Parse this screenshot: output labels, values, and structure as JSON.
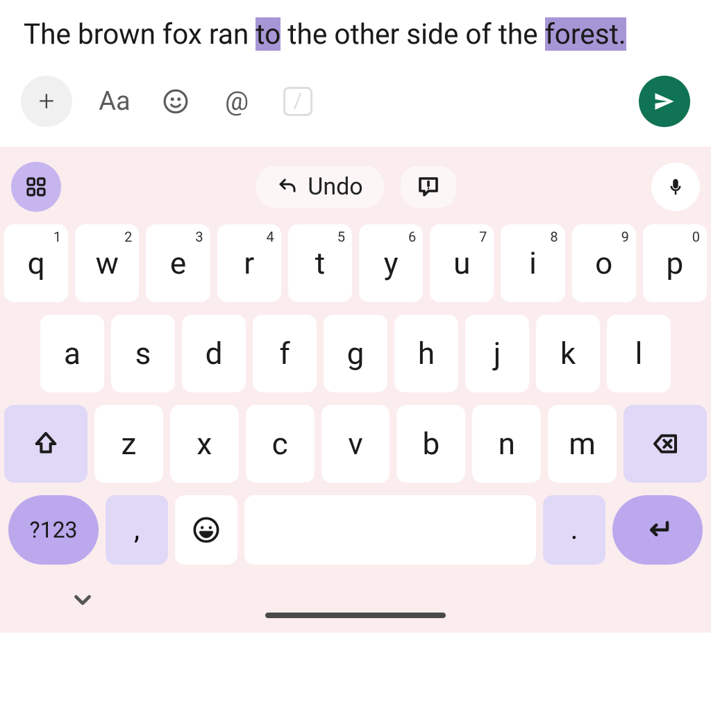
{
  "input": {
    "segments": [
      {
        "text": "The brown fox ran ",
        "highlight": false
      },
      {
        "text": "to",
        "highlight": true
      },
      {
        "text": " the other side of the ",
        "highlight": false
      },
      {
        "text": "forest.",
        "highlight": true
      }
    ]
  },
  "toolbar": {
    "plus_label": "+",
    "format_label": "Aa",
    "at_label": "@",
    "slash_label": "/"
  },
  "suggestions": {
    "undo_label": "Undo"
  },
  "keyboard": {
    "row1": [
      {
        "letter": "q",
        "num": "1"
      },
      {
        "letter": "w",
        "num": "2"
      },
      {
        "letter": "e",
        "num": "3"
      },
      {
        "letter": "r",
        "num": "4"
      },
      {
        "letter": "t",
        "num": "5"
      },
      {
        "letter": "y",
        "num": "6"
      },
      {
        "letter": "u",
        "num": "7"
      },
      {
        "letter": "i",
        "num": "8"
      },
      {
        "letter": "o",
        "num": "9"
      },
      {
        "letter": "p",
        "num": "0"
      }
    ],
    "row2": [
      {
        "letter": "a"
      },
      {
        "letter": "s"
      },
      {
        "letter": "d"
      },
      {
        "letter": "f"
      },
      {
        "letter": "g"
      },
      {
        "letter": "h"
      },
      {
        "letter": "j"
      },
      {
        "letter": "k"
      },
      {
        "letter": "l"
      }
    ],
    "row3": [
      {
        "letter": "z"
      },
      {
        "letter": "x"
      },
      {
        "letter": "c"
      },
      {
        "letter": "v"
      },
      {
        "letter": "b"
      },
      {
        "letter": "n"
      },
      {
        "letter": "m"
      }
    ],
    "symbols_label": "?123",
    "comma_label": ",",
    "period_label": "."
  }
}
